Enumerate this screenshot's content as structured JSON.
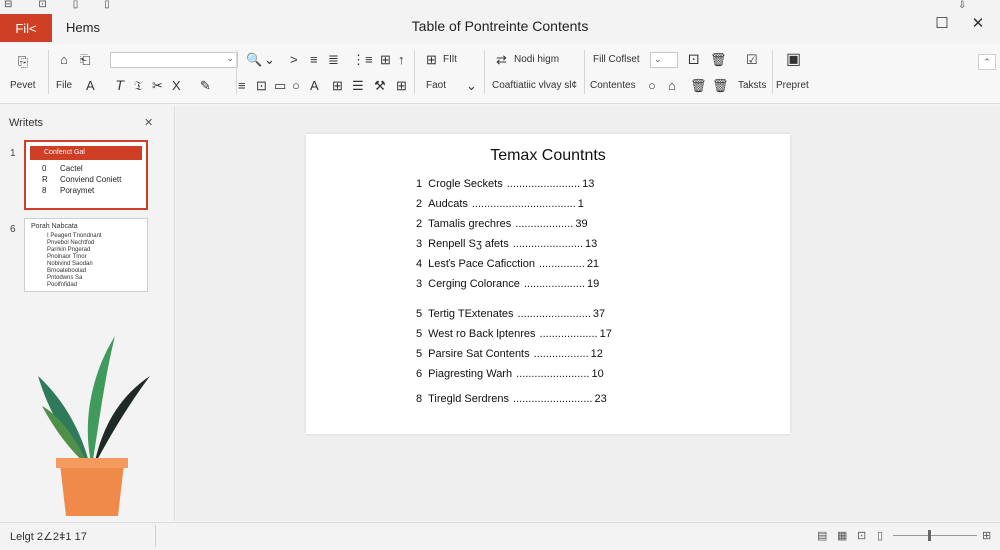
{
  "titlebar": {
    "title": "Table of Pontreinte Contents",
    "file_tab": "Fil<",
    "home_tab": "Hems",
    "quick_access": [
      "⊟",
      "⊡",
      "▯",
      "▯"
    ],
    "minimize": "",
    "maximize": "☐",
    "close": "✕",
    "topright_mini": "⇩",
    "accent": "#cf3f25"
  },
  "ribbon": {
    "group_labels": {
      "prevet": "Pevet",
      "file": "File",
      "font": "Faot",
      "paragraph": "Coaftiatiic vlvay sl¢",
      "edit": "Fill Coffest",
      "content": "Contentes",
      "tools": "Taksts",
      "prepret": "Prepret"
    },
    "labels": {
      "font_top": "FIlt",
      "style_top": "Nodi higm",
      "edit_top": "Fill Coflset"
    },
    "font_combo": "",
    "font_combo_arrow": "⌄",
    "size_combo": "⌄",
    "icons": {
      "clipboard": "⎘",
      "format_painter": "⌂",
      "copy": "⎗",
      "font_color": "A",
      "italic": "𝘛",
      "strike": "𝔗",
      "cut": "✂",
      "close_x": "X",
      "pen": "✎",
      "search": "🔍",
      "goto": ">",
      "align_left": "≡",
      "align_center": "≣",
      "bullet": "⋮≡",
      "up": "↑",
      "insert": "⊞",
      "shape": "⊡",
      "rect": "▭",
      "circle": "○",
      "letterA": "A",
      "table": "⊞",
      "list": "☰",
      "wrench": "⚒",
      "grid": "⊞",
      "replace": "⇄",
      "dice": "⚀",
      "trash": "🗑",
      "checklist": "☑",
      "sheet": "▤",
      "present": "▣"
    },
    "collapse": "⌃"
  },
  "left_pane": {
    "title": "Writets",
    "close": "✕",
    "slides": [
      {
        "number": "1",
        "header": "Confenct Gal",
        "lines": [
          "Cactel",
          "Conviend Coniett",
          "Poraymet"
        ],
        "markers": [
          "0",
          "R",
          "8"
        ]
      },
      {
        "number": "6",
        "header": "Porah Nabcata",
        "lines": [
          "I Peagert Tnondnant",
          "Pnvebol Nechtfod",
          "Parrkin Pngerad",
          "Pnolnaor Tmor",
          "Nobivind Saodan",
          "Brnoateboolad",
          "Pntodwns Sa",
          "Poolfnfidad"
        ]
      }
    ]
  },
  "slide": {
    "title": "Temax Countnts",
    "rows": [
      {
        "num": "1",
        "text": "Crogle Seckets",
        "dots": "........................",
        "page": "13"
      },
      {
        "num": "2",
        "text": "Audcats",
        "dots": "..................................",
        "page": "1"
      },
      {
        "num": "2",
        "text": "Tamalis grechres",
        "dots": "...................",
        "page": "39"
      },
      {
        "num": "3",
        "text": "Renpell Sʒ afets",
        "dots": ".......................",
        "page": "13"
      },
      {
        "num": "4",
        "text": "Lesťs Pace Caficction",
        "dots": "...............",
        "page": "21"
      },
      {
        "num": "3",
        "text": "Cerging Colorance",
        "dots": "....................",
        "page": "19"
      },
      {
        "num": "5",
        "text": "Tertig TExtenates",
        "dots": "........................",
        "page": "37"
      },
      {
        "num": "5",
        "text": "West ro Back lptenres",
        "dots": "...................",
        "page": "17"
      },
      {
        "num": "5",
        "text": "Parsire Sat Contents",
        "dots": "..................",
        "page": "12"
      },
      {
        "num": "6",
        "text": "Piagresting Warh",
        "dots": "........................",
        "page": "10"
      },
      {
        "num": "8",
        "text": "Tiregld Serdrens",
        "dots": "..........................",
        "page": "23"
      }
    ]
  },
  "statusbar": {
    "text": "Lelgt 2∠2ǂ1 17",
    "icons": {
      "notes": "▤",
      "view": "▦",
      "reading": "⊡",
      "present": "▯",
      "plus": "⊞"
    }
  }
}
